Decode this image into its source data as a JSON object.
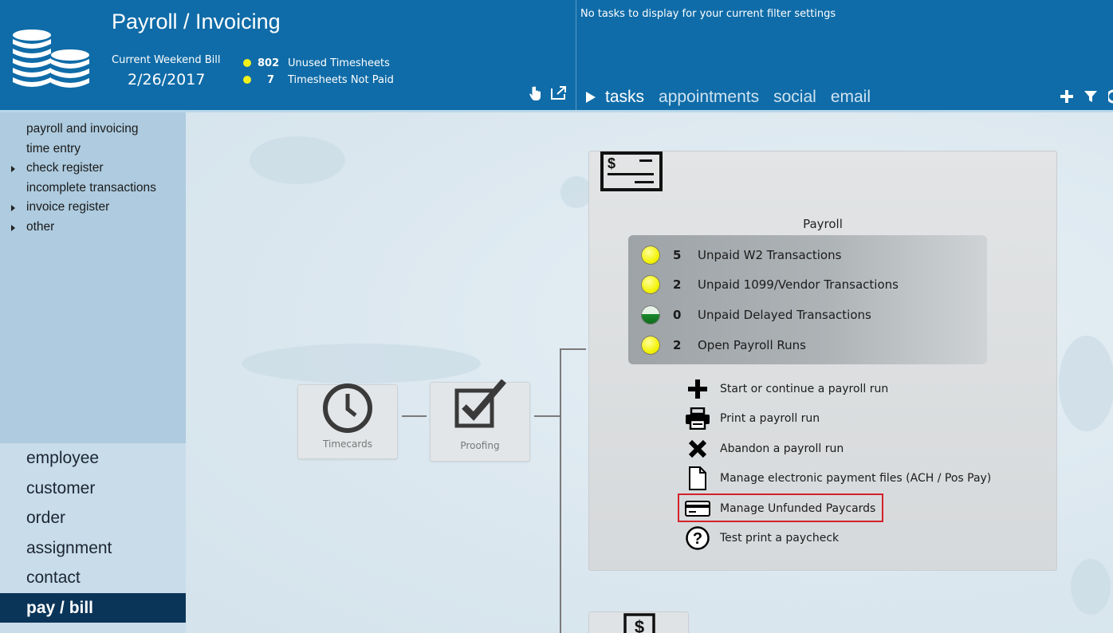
{
  "header": {
    "title": "Payroll / Invoicing",
    "weekend_label": "Current Weekend Bill",
    "weekend_date": "2/26/2017",
    "stats": [
      {
        "count": "802",
        "label": "Unused Timesheets"
      },
      {
        "count": "7",
        "label": "Timesheets Not Paid"
      }
    ],
    "icons": [
      "hand-pointer-icon",
      "popout-icon"
    ]
  },
  "activity": {
    "message": "No tasks to display for your current filter settings",
    "tabs": [
      "tasks",
      "appointments",
      "social",
      "email"
    ],
    "active_tab": "tasks",
    "tools": [
      "plus-icon",
      "filter-icon",
      "refresh-icon"
    ]
  },
  "sidebar": {
    "sub_items": [
      {
        "label": "payroll and invoicing",
        "expandable": false
      },
      {
        "label": "time entry",
        "expandable": false
      },
      {
        "label": "check register",
        "expandable": true
      },
      {
        "label": "incomplete transactions",
        "expandable": false
      },
      {
        "label": "invoice register",
        "expandable": true
      },
      {
        "label": "other",
        "expandable": true
      }
    ],
    "main_items": [
      "employee",
      "customer",
      "order",
      "assignment",
      "contact",
      "pay / bill"
    ],
    "active_main": "pay / bill"
  },
  "workflow": {
    "steps": [
      {
        "label": "Timecards",
        "icon": "clock-icon"
      },
      {
        "label": "Proofing",
        "icon": "checkbox-icon"
      }
    ]
  },
  "payroll": {
    "icon": "check-icon",
    "title": "Payroll",
    "status": [
      {
        "count": "5",
        "label": "Unpaid W2 Transactions",
        "light": "yellow"
      },
      {
        "count": "2",
        "label": "Unpaid 1099/Vendor Transactions",
        "light": "yellow"
      },
      {
        "count": "0",
        "label": "Unpaid Delayed Transactions",
        "light": "green"
      },
      {
        "count": "2",
        "label": "Open Payroll Runs",
        "light": "yellow"
      }
    ],
    "actions": [
      {
        "label": "Start or continue a payroll run",
        "icon": "plus-icon"
      },
      {
        "label": "Print a payroll run",
        "icon": "printer-icon"
      },
      {
        "label": "Abandon a payroll run",
        "icon": "x-icon"
      },
      {
        "label": "Manage electronic payment files (ACH / Pos Pay)",
        "icon": "file-icon"
      },
      {
        "label": "Manage Unfunded Paycards",
        "icon": "credit-card-icon"
      },
      {
        "label": "Test print a paycheck",
        "icon": "question-icon"
      }
    ],
    "highlighted_action": "Manage Unfunded Paycards"
  },
  "colors": {
    "header_bg": "#0f6ca8",
    "active_nav_bg": "#0b3558",
    "highlight_border": "#d3212a",
    "status_yellow": "#f2f200",
    "status_green": "#1c8a2c"
  }
}
